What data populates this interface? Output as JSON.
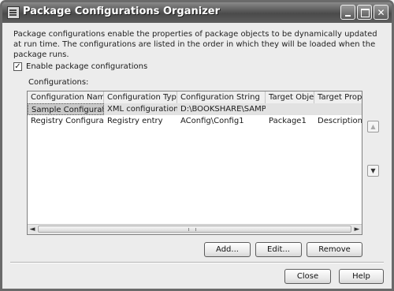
{
  "window": {
    "title": "Package Configurations Organizer"
  },
  "description": "Package configurations enable the properties of package objects to be dynamically updated at run time. The configurations are listed in the order in which they will be loaded when the package runs.",
  "enable_checkbox": {
    "label": "Enable package configurations",
    "checked": true,
    "mark": "✓"
  },
  "configurations_label": "Configurations:",
  "table": {
    "columns": [
      "Configuration Name",
      "Configuration Type",
      "Configuration String",
      "Target Object",
      "Target Prop..."
    ],
    "rows": [
      [
        "Sample Configuration",
        "XML configuration file",
        "D:\\BOOKSHARE\\SAMPLE...",
        "",
        ""
      ],
      [
        "Registry Configuration",
        "Registry entry",
        "AConfig\\Config1",
        "Package1",
        "Description"
      ]
    ],
    "selected_row": 0
  },
  "scroll": {
    "left_icon": "◄",
    "right_icon": "►"
  },
  "move": {
    "up_icon": "▲",
    "down_icon": "▼"
  },
  "buttons": {
    "add": "Add...",
    "edit": "Edit...",
    "remove": "Remove",
    "close": "Close",
    "help": "Help"
  },
  "colors": {
    "titlebar": "#555555",
    "selected_row": "#c9c9c9"
  }
}
